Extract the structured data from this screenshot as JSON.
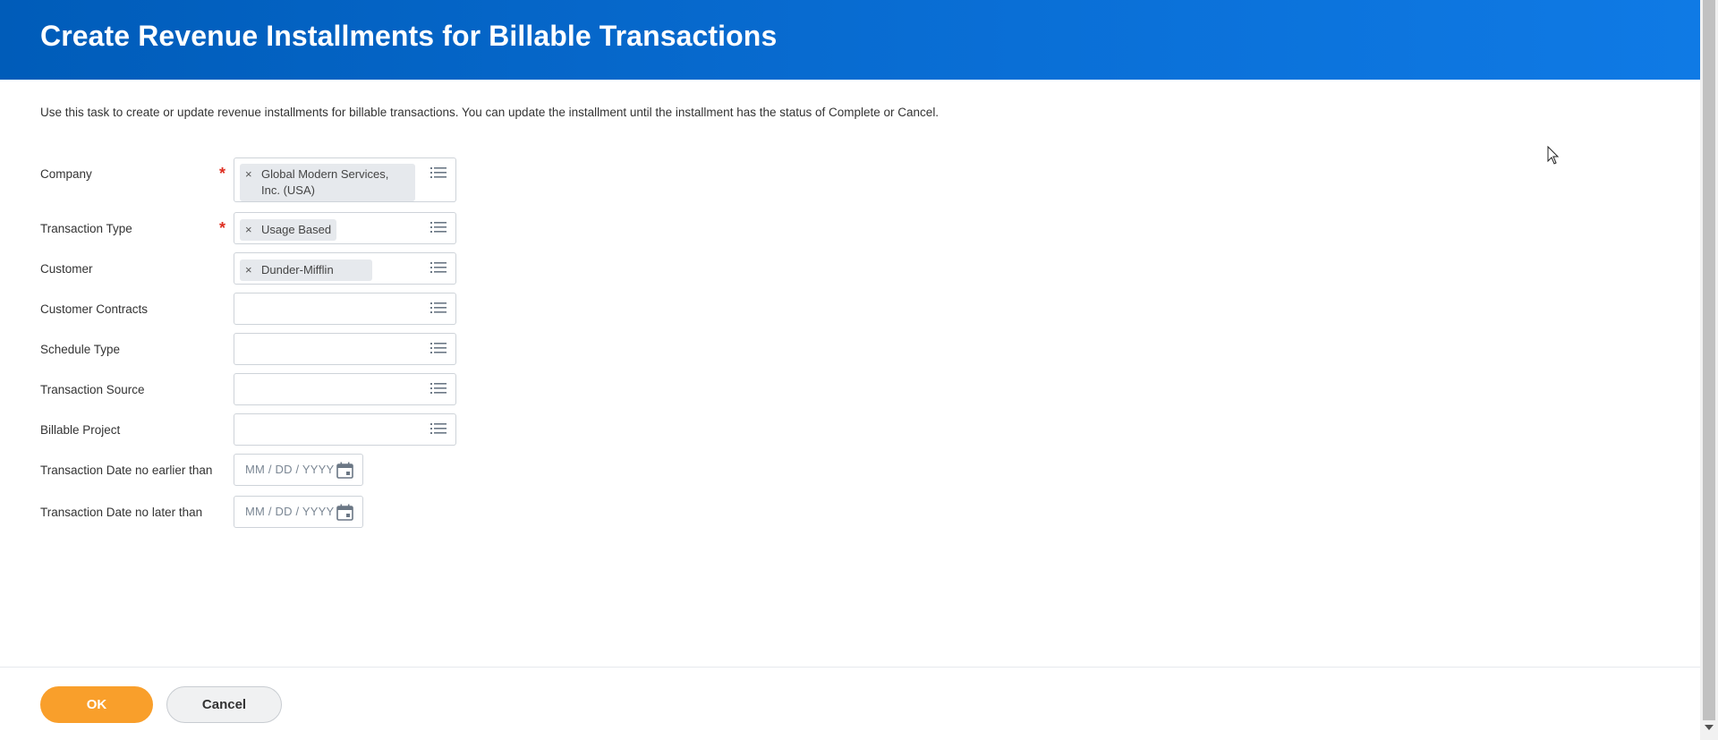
{
  "page": {
    "title": "Create Revenue Installments for Billable Transactions",
    "instructions": "Use this task to create or update revenue installments for billable transactions. You can update the installment until the installment has the status of Complete or Cancel."
  },
  "fields": {
    "company": {
      "label": "Company",
      "required_mark": "*",
      "value": "Global Modern Services, Inc. (USA)"
    },
    "transaction_type": {
      "label": "Transaction Type",
      "required_mark": "*",
      "value": "Usage Based"
    },
    "customer": {
      "label": "Customer",
      "value": "Dunder-Mifflin"
    },
    "customer_contracts": {
      "label": "Customer Contracts"
    },
    "schedule_type": {
      "label": "Schedule Type"
    },
    "transaction_source": {
      "label": "Transaction Source"
    },
    "billable_project": {
      "label": "Billable Project"
    },
    "date_from": {
      "label": "Transaction Date no earlier than",
      "placeholder": "MM / DD / YYYY"
    },
    "date_to": {
      "label": "Transaction Date no later than",
      "placeholder": "MM / DD / YYYY"
    }
  },
  "pill_remove_glyph": "×",
  "icons": {
    "prompt": "list-icon",
    "date": "calendar-icon",
    "remove": "close-icon"
  },
  "footer": {
    "ok_label": "OK",
    "cancel_label": "Cancel"
  },
  "colors": {
    "header": "#005cb9",
    "ok_button": "#f99f2b",
    "required": "#de2e21"
  }
}
